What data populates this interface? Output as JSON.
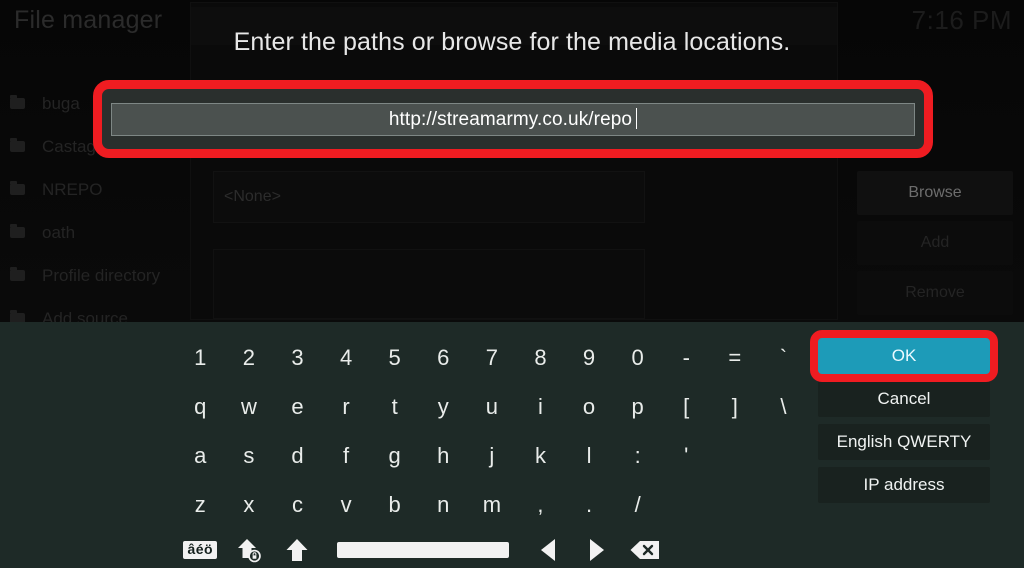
{
  "window": {
    "title": "File manager",
    "clock": "7:16 PM"
  },
  "sidebar": {
    "items": [
      {
        "label": "buga",
        "icon": "folder-icon"
      },
      {
        "label": "Castagn",
        "icon": "folder-icon"
      },
      {
        "label": "NREPO",
        "icon": "folder-icon"
      },
      {
        "label": "oath",
        "icon": "folder-icon"
      },
      {
        "label": "Profile directory",
        "icon": "folder-icon"
      },
      {
        "label": "Add source",
        "icon": "folder-icon"
      }
    ]
  },
  "source_dialog": {
    "path_value": "<None>",
    "browse_label": "Browse",
    "add_label": "Add",
    "remove_label": "Remove"
  },
  "keyboard_dialog": {
    "prompt": "Enter the paths or browse for the media locations.",
    "input_value": "http://streamarmy.co.uk/repo",
    "rows": [
      [
        "1",
        "2",
        "3",
        "4",
        "5",
        "6",
        "7",
        "8",
        "9",
        "0",
        "-",
        "=",
        "`"
      ],
      [
        "q",
        "w",
        "e",
        "r",
        "t",
        "y",
        "u",
        "i",
        "o",
        "p",
        "[",
        "]",
        "\\"
      ],
      [
        "a",
        "s",
        "d",
        "f",
        "g",
        "h",
        "j",
        "k",
        "l",
        ":",
        "'"
      ],
      [
        "z",
        "x",
        "c",
        "v",
        "b",
        "n",
        "m",
        ",",
        ".",
        "/"
      ]
    ],
    "function_keys": [
      {
        "name": "accent-key",
        "label": "âéö"
      },
      {
        "name": "caps-lock-key",
        "label": ""
      },
      {
        "name": "shift-key",
        "label": ""
      },
      {
        "name": "space-key",
        "label": ""
      },
      {
        "name": "cursor-left-key",
        "label": ""
      },
      {
        "name": "cursor-right-key",
        "label": ""
      },
      {
        "name": "backspace-key",
        "label": ""
      }
    ],
    "actions": [
      {
        "label": "OK",
        "selected": true
      },
      {
        "label": "Cancel",
        "selected": false
      },
      {
        "label": "English QWERTY",
        "selected": false
      },
      {
        "label": "IP address",
        "selected": false
      }
    ]
  },
  "annotations": {
    "color": "#ef1c21",
    "targets": [
      "text-input-field",
      "ok-button"
    ]
  },
  "colors": {
    "accent": "#1d9bb8",
    "keyboard_bg": "#1e2a27",
    "button_bg": "#19221f",
    "annotation_red": "#ef1c21",
    "input_bg": "#4b514f"
  }
}
